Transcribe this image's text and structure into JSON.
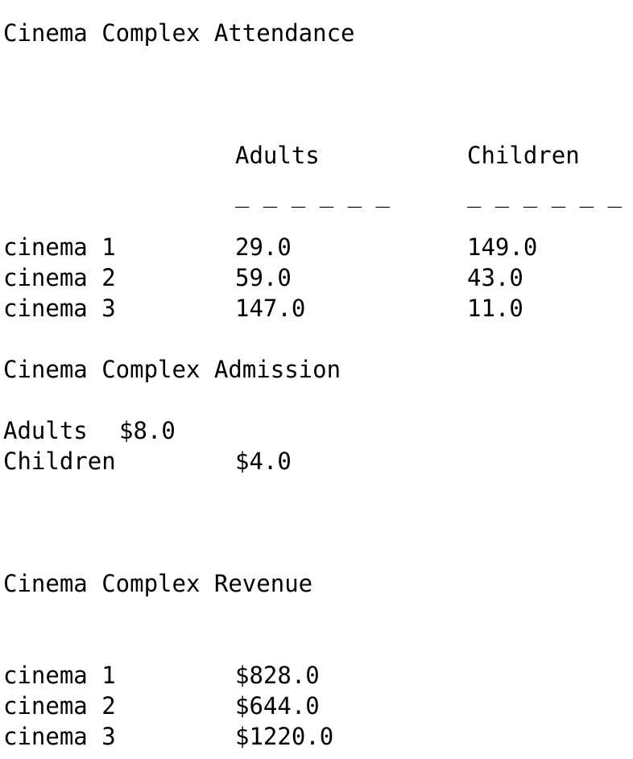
{
  "attendance": {
    "title": "Cinema Complex Attendance",
    "headers": {
      "adults": "Adults",
      "children": "Children"
    },
    "underlines": {
      "adults": "_ _ _ _ _ _",
      "children": "_ _ _ _ _ _"
    },
    "rows": [
      {
        "label": "cinema 1",
        "adults": "29.0",
        "children": "149.0"
      },
      {
        "label": "cinema 2",
        "adults": "59.0",
        "children": "43.0"
      },
      {
        "label": "cinema 3",
        "adults": "147.0",
        "children": "11.0"
      }
    ]
  },
  "admission": {
    "title": "Cinema Complex Admission",
    "rows": [
      {
        "label": "Adults",
        "price": "$8.0"
      },
      {
        "label": "Children",
        "price": "$4.0"
      }
    ]
  },
  "revenue": {
    "title": "Cinema Complex Revenue",
    "rows": [
      {
        "label": "cinema 1",
        "amount": "$828.0"
      },
      {
        "label": "cinema 2",
        "amount": "$644.0"
      },
      {
        "label": "cinema 3",
        "amount": "$1220.0"
      }
    ]
  }
}
